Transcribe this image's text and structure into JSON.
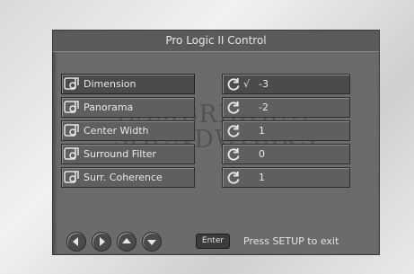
{
  "title": "Pro Logic II Control",
  "watermark": {
    "line1": "CAMBRIDGE®",
    "line2": "SOUNDWORKS"
  },
  "menu": [
    {
      "label": "Dimension",
      "value": "-3",
      "check": "√"
    },
    {
      "label": "Panorama",
      "value": "-2"
    },
    {
      "label": "Center Width",
      "value": "1"
    },
    {
      "label": "Surround Filter",
      "value": "0"
    },
    {
      "label": "Surr. Coherence",
      "value": "1"
    }
  ],
  "footer": {
    "nav": [
      "left-arrow-icon",
      "right-arrow-icon",
      "up-arrow-icon",
      "down-arrow-icon"
    ],
    "enter_label": "Enter",
    "hint": "Press SETUP to exit"
  }
}
